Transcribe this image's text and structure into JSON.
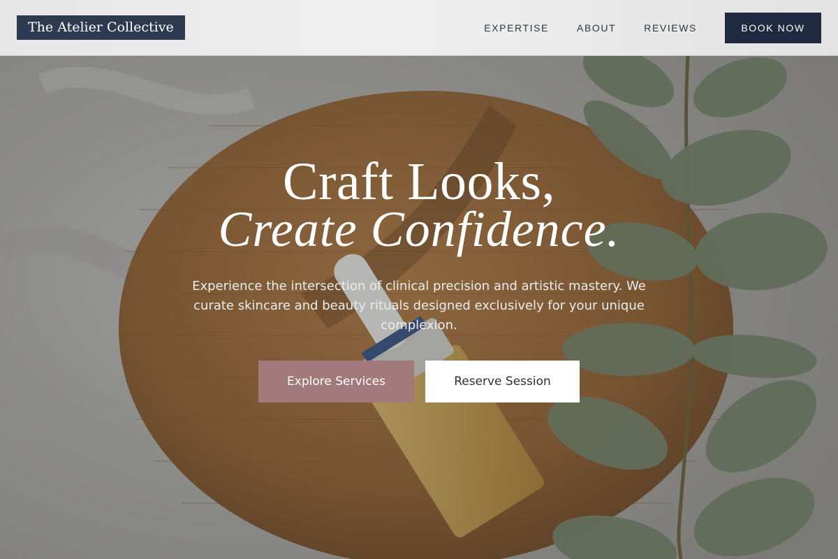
{
  "brand": {
    "name": "The Atelier Collective"
  },
  "nav": {
    "links": [
      {
        "label": "EXPERTISE"
      },
      {
        "label": "ABOUT"
      },
      {
        "label": "REVIEWS"
      }
    ],
    "cta_label": "BOOK NOW"
  },
  "hero": {
    "headline_line1": "Craft Looks,",
    "headline_line2": "Create Confidence.",
    "subtext": "Experience the intersection of clinical precision and artistic mastery. We curate skincare and beauty rituals designed exclusively for your unique complexion.",
    "primary_button": "Explore Services",
    "secondary_button": "Reserve Session",
    "background_image": "serum-dropper-bottle-on-wooden-tray-with-eucalyptus"
  },
  "colors": {
    "nav_background": "#ececec",
    "brand_navy": "#1f2940",
    "accent_rose": "#a27a7b",
    "text_light": "#ffffff"
  }
}
